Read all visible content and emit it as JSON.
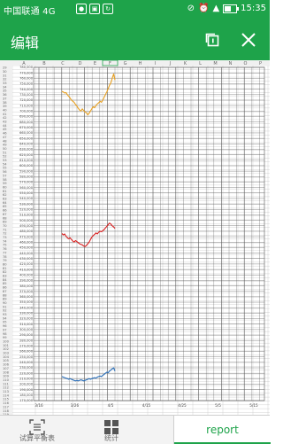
{
  "status_bar": {
    "carrier": "中国联通 4G",
    "carrier_icons": [
      "notification-icon",
      "image-icon",
      "sync-icon"
    ],
    "right_icons": [
      "mute-icon",
      "alarm-icon",
      "signal-icon"
    ],
    "battery_level": 0.55,
    "time": "15:35"
  },
  "app_bar": {
    "title": "编辑",
    "actions": [
      "copy-icon",
      "close-icon"
    ]
  },
  "sheet": {
    "row_numbers": [
      "29",
      "30",
      "31",
      "32",
      "33",
      "34",
      "35",
      "36",
      "37",
      "38",
      "39",
      "40",
      "41",
      "42",
      "43",
      "44",
      "45",
      "46",
      "47",
      "48",
      "49",
      "50",
      "51",
      "52",
      "53",
      "54",
      "55",
      "56",
      "57",
      "58",
      "59",
      "60",
      "61",
      "62",
      "63",
      "64",
      "65",
      "66",
      "67",
      "68",
      "69",
      "70",
      "71",
      "72",
      "73",
      "74",
      "75",
      "76",
      "77",
      "78",
      "79",
      "80",
      "81",
      "82",
      "83",
      "84",
      "85",
      "86",
      "87",
      "88",
      "89",
      "90",
      "91",
      "92",
      "93",
      "94",
      "95",
      "96",
      "97",
      "98",
      "99",
      "100",
      "101",
      "102",
      "103",
      "104",
      "105",
      "106",
      "107",
      "108",
      "109",
      "110",
      "111",
      "112",
      "113",
      "114",
      "115",
      "116",
      "117",
      "118",
      "119",
      "120"
    ],
    "col_letters": [
      "A",
      "B",
      "C",
      "D",
      "E",
      "F",
      "G",
      "H",
      "I",
      "J",
      "K",
      "L",
      "M",
      "N",
      "O",
      "P",
      "Q",
      "R"
    ],
    "colors": {
      "grid": "#c8c8c8",
      "chart_grid": "#555555",
      "header_bg": "#f0f0f0",
      "selected_col": "#1ea34a"
    }
  },
  "chart_data": {
    "type": "line",
    "ylim": [
      170000,
      780000
    ],
    "y_ticks": [
      "780,000",
      "770,000",
      "760,000",
      "750,000",
      "740,000",
      "730,000",
      "720,000",
      "710,000",
      "700,000",
      "690,000",
      "680,000",
      "670,000",
      "660,000",
      "650,000",
      "640,000",
      "630,000",
      "620,000",
      "610,000",
      "600,000",
      "590,000",
      "580,000",
      "570,000",
      "560,000",
      "550,000",
      "540,000",
      "530,000",
      "520,000",
      "510,000",
      "500,000",
      "490,000",
      "480,000",
      "470,000",
      "460,000",
      "450,000",
      "440,000",
      "430,000",
      "420,000",
      "410,000",
      "400,000",
      "390,000",
      "380,000",
      "370,000",
      "360,000",
      "350,000",
      "340,000",
      "330,000",
      "320,000",
      "310,000",
      "300,000",
      "290,000",
      "280,000",
      "270,000",
      "260,000",
      "250,000",
      "240,000",
      "230,000",
      "220,000",
      "210,000",
      "200,000",
      "190,000",
      "180,000",
      "170,000"
    ],
    "x_ticks": [
      "3/16",
      "3/26",
      "4/5",
      "4/15",
      "4/25",
      "5/5",
      "5/15"
    ],
    "series": [
      {
        "color": "#e8a020",
        "x": [
          0,
          1,
          2,
          3,
          4,
          5,
          6,
          7,
          8,
          9,
          10,
          11,
          12,
          13,
          14,
          15,
          16,
          17,
          18,
          19,
          20,
          21,
          22,
          23,
          24,
          25,
          26,
          27,
          28,
          29,
          30,
          31,
          32,
          33,
          34,
          35,
          36,
          37,
          38,
          39
        ],
        "values": [
          736000,
          735000,
          733000,
          734000,
          730000,
          727000,
          724000,
          720000,
          718000,
          716000,
          712000,
          709000,
          705000,
          702000,
          700000,
          704000,
          701000,
          698000,
          697000,
          693000,
          696000,
          700000,
          704000,
          708000,
          706000,
          710000,
          713000,
          715000,
          718000,
          716000,
          720000,
          725000,
          730000,
          735000,
          741000,
          747000,
          752000,
          760000,
          768000,
          757000
        ]
      },
      {
        "color": "#d82020",
        "x": [
          0,
          1,
          2,
          3,
          4,
          5,
          6,
          7,
          8,
          9,
          10,
          11,
          12,
          13,
          14,
          15,
          16,
          17,
          18,
          19,
          20,
          21,
          22,
          23,
          24,
          25,
          26,
          27,
          28,
          29,
          30,
          31,
          32,
          33,
          34,
          35,
          36,
          37,
          38,
          39
        ],
        "values": [
          476000,
          473000,
          475000,
          471000,
          468000,
          466000,
          468000,
          465000,
          462000,
          460000,
          463000,
          461000,
          459000,
          457000,
          456000,
          455000,
          453000,
          452000,
          454000,
          457000,
          460000,
          465000,
          469000,
          472000,
          474000,
          477000,
          475000,
          478000,
          480000,
          479000,
          481000,
          483000,
          486000,
          489000,
          492000,
          495000,
          493000,
          490000,
          488000,
          485000
        ]
      },
      {
        "color": "#2a6eb8",
        "x": [
          0,
          1,
          2,
          3,
          4,
          5,
          6,
          7,
          8,
          9,
          10,
          11,
          12,
          13,
          14,
          15,
          16,
          17,
          18,
          19,
          20,
          21,
          22,
          23,
          24,
          25,
          26,
          27,
          28,
          29,
          30,
          31,
          32,
          33,
          34,
          35,
          36,
          37,
          38,
          39
        ],
        "values": [
          214000,
          213000,
          212000,
          211000,
          210000,
          209000,
          210000,
          209000,
          208000,
          207000,
          206000,
          207000,
          206000,
          207000,
          208000,
          207000,
          206000,
          207000,
          208000,
          209000,
          210000,
          209000,
          210000,
          211000,
          212000,
          211000,
          213000,
          214000,
          215000,
          214000,
          216000,
          218000,
          220000,
          222000,
          221000,
          224000,
          226000,
          228000,
          230000,
          224000
        ]
      }
    ]
  },
  "bottom_bar": {
    "tabs": [
      {
        "label": "试算平衡表",
        "icon": "scan-icon"
      },
      {
        "label": "统计",
        "icon": "grid-icon"
      },
      {
        "label": "report",
        "icon": ""
      }
    ]
  }
}
